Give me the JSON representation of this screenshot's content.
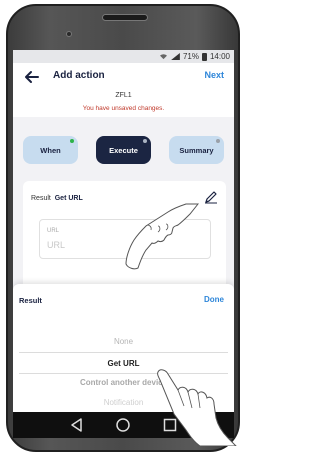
{
  "status_bar": {
    "battery": "71%",
    "time": "14:00"
  },
  "header": {
    "title": "Add action",
    "next_label": "Next",
    "subtitle": "ZFL1",
    "warning": "You have unsaved changes."
  },
  "steps": [
    {
      "label": "When",
      "dot_color": "#2db34a"
    },
    {
      "label": "Execute",
      "dot_color": "#aab3c2"
    },
    {
      "label": "Summary",
      "dot_color": "#9aa0a8"
    }
  ],
  "card": {
    "result_label": "Result",
    "result_value": "Get URL",
    "url_label": "URL",
    "url_placeholder": "URL"
  },
  "sheet": {
    "title": "Result",
    "done_label": "Done",
    "options": [
      "None",
      "Get URL",
      "Control another device",
      "Notification"
    ],
    "selected": "Get URL"
  },
  "icons": {
    "back": "arrow-left-icon",
    "edit": "pencil-icon",
    "nav_back": "triangle-back-icon",
    "nav_home": "circle-home-icon",
    "nav_recents": "square-recents-icon",
    "gesture": "hand-pointer-icon"
  },
  "colors": {
    "accent": "#2e86d9",
    "navy": "#1b2542",
    "step_inactive": "#c7dcef",
    "warning": "#c0392b"
  }
}
